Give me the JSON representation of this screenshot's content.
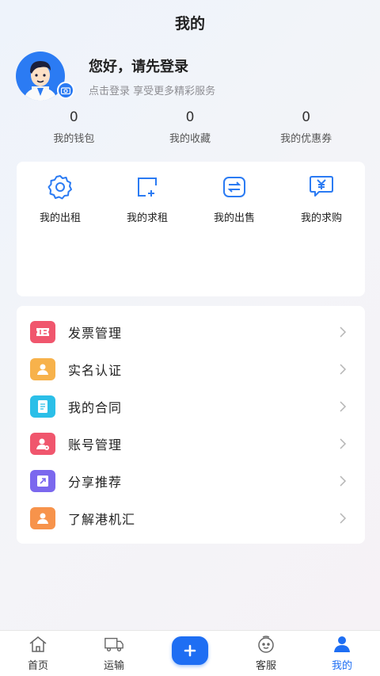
{
  "header": {
    "title": "我的"
  },
  "profile": {
    "greeting": "您好，请先登录",
    "hint": "点击登录 享受更多精彩服务"
  },
  "stats": [
    {
      "value": "0",
      "label": "我的钱包"
    },
    {
      "value": "0",
      "label": "我的收藏"
    },
    {
      "value": "0",
      "label": "我的优惠券"
    }
  ],
  "actions": [
    {
      "label": "我的出租",
      "icon": "gear-icon"
    },
    {
      "label": "我的求租",
      "icon": "add-square-icon"
    },
    {
      "label": "我的出售",
      "icon": "exchange-icon"
    },
    {
      "label": "我的求购",
      "icon": "yuan-chat-icon"
    }
  ],
  "menu": [
    {
      "label": "发票管理",
      "icon": "invoice-icon",
      "color": "#f0566d"
    },
    {
      "label": "实名认证",
      "icon": "id-verify-icon",
      "color": "#f7b24b"
    },
    {
      "label": "我的合同",
      "icon": "contract-icon",
      "color": "#2bbfe8"
    },
    {
      "label": "账号管理",
      "icon": "account-icon",
      "color": "#f0566d"
    },
    {
      "label": "分享推荐",
      "icon": "share-icon",
      "color": "#7b68ee"
    },
    {
      "label": "了解港机汇",
      "icon": "about-icon",
      "color": "#f7934b"
    }
  ],
  "tabs": [
    {
      "label": "首页",
      "icon": "home-icon"
    },
    {
      "label": "运输",
      "icon": "truck-icon"
    },
    {
      "label": "",
      "icon": "plus-icon"
    },
    {
      "label": "客服",
      "icon": "service-icon"
    },
    {
      "label": "我的",
      "icon": "user-icon"
    }
  ],
  "colors": {
    "accent": "#1e6ef3",
    "icon_blue": "#2b7bf3"
  }
}
